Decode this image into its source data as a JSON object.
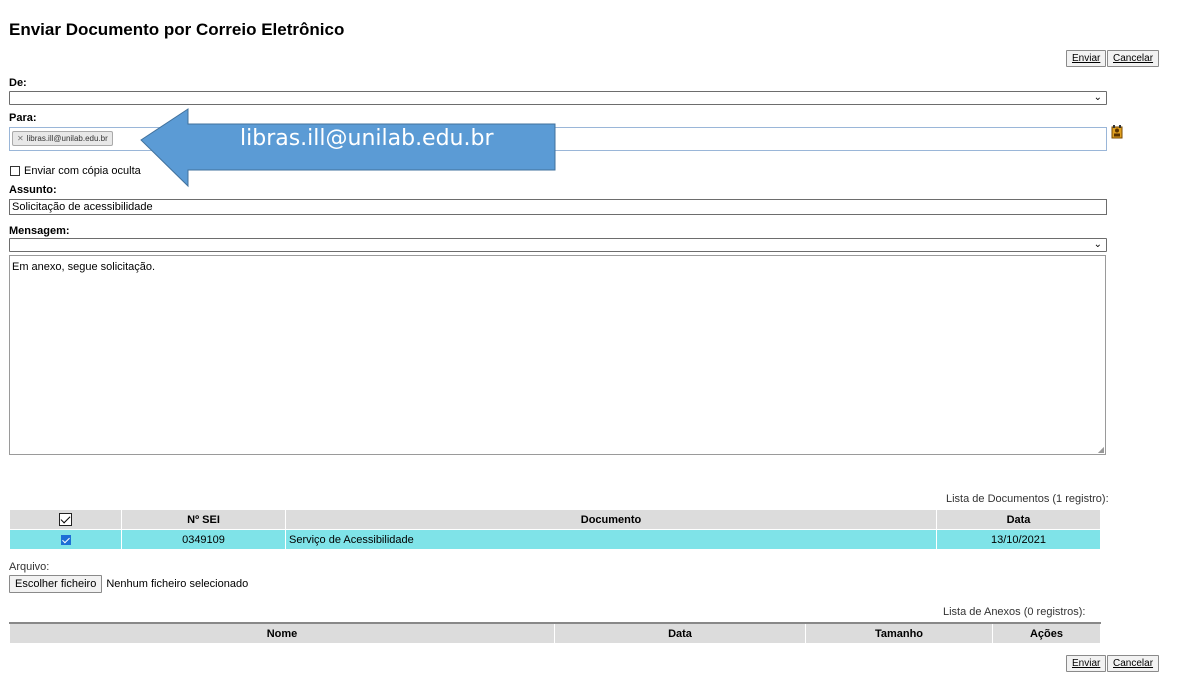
{
  "page": {
    "title": "Enviar Documento por Correio Eletrônico"
  },
  "toolbar": {
    "send_label": "Enviar",
    "cancel_label": "Cancelar"
  },
  "form": {
    "from_label": "De:",
    "from_value": "",
    "to_label": "Para:",
    "to_recipient": "libras.ill@unilab.edu.br",
    "annotation_text": "libras.ill@unilab.edu.br",
    "bcc_label": "Enviar com cópia oculta",
    "subject_label": "Assunto:",
    "subject_value": "Solicitação de acessibilidade",
    "message_label": "Mensagem:",
    "message_template": "",
    "message_body": "Em anexo, segue solicitação."
  },
  "documents": {
    "caption": "Lista de Documentos (1 registro):",
    "headers": [
      "Nº SEI",
      "Documento",
      "Data"
    ],
    "rows": [
      {
        "sei": "0349109",
        "documento": "Serviço de Acessibilidade",
        "data": "13/10/2021",
        "checked": true
      }
    ]
  },
  "attachment": {
    "label": "Arquivo:",
    "choose_button": "Escolher ficheiro",
    "no_file_text": "Nenhum ficheiro selecionado"
  },
  "attachments_list": {
    "caption": "Lista de Anexos (0 registros):",
    "headers": [
      "Nome",
      "Data",
      "Tamanho",
      "Ações"
    ]
  },
  "colors": {
    "annotation_arrow": "#5b9bd5",
    "selected_row": "#7fe3e8",
    "header_bg": "#dcdcdc"
  },
  "icons": {
    "recipients_icon": "contacts-icon"
  }
}
